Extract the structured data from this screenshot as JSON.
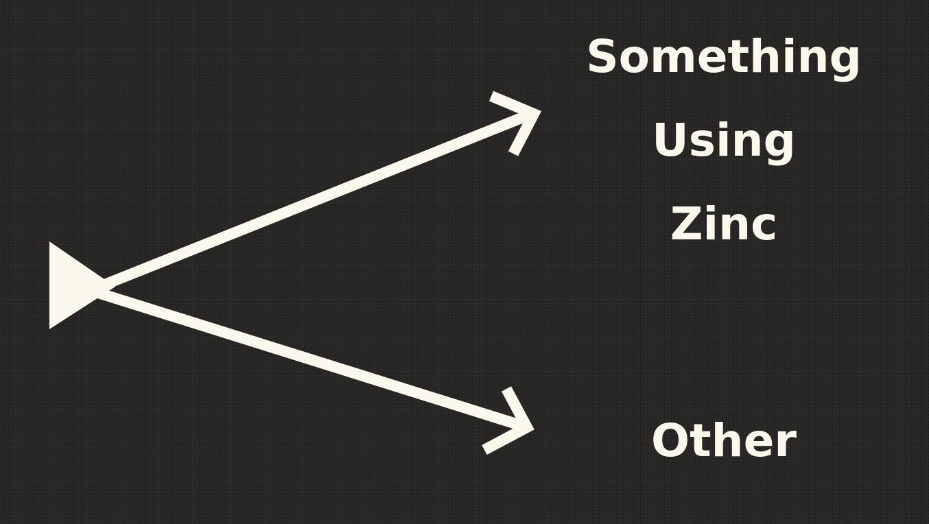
{
  "diagram": {
    "labels": {
      "top_line1": "Something",
      "top_line2": "Using",
      "top_line3": "Zinc",
      "bottom": "Other"
    },
    "colors": {
      "background": "#262524",
      "foreground": "#fbf8ee"
    }
  }
}
